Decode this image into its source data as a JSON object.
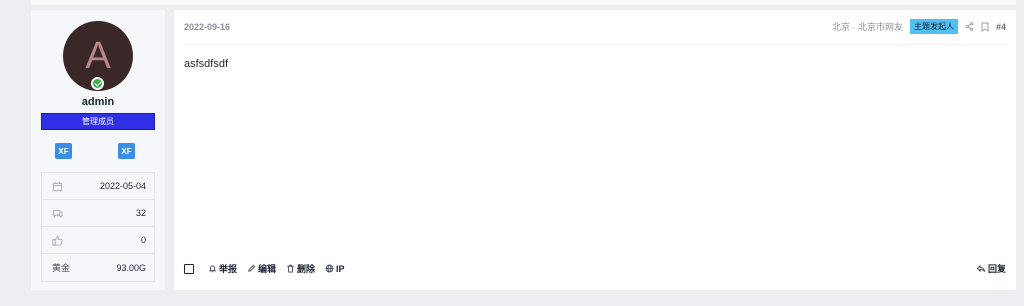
{
  "user": {
    "avatar_letter": "A",
    "name": "admin",
    "role": "管理成员",
    "stats": [
      {
        "icon": "calendar-icon",
        "label": "",
        "value": "2022-05-04"
      },
      {
        "icon": "message-icon",
        "label": "",
        "value": "32"
      },
      {
        "icon": "thumbs-up-icon",
        "label": "",
        "value": "0"
      },
      {
        "icon": "",
        "label": "黄金",
        "value": "93.00G"
      }
    ]
  },
  "post": {
    "date": "2022-09-16",
    "location": "北京 · 北京市网友",
    "starter_badge": "主题发起人",
    "number": "#4",
    "content": "asfsdfsdf",
    "actions": {
      "report": "举报",
      "edit": "编辑",
      "delete": "删除",
      "ip": "IP",
      "reply": "回复"
    }
  },
  "colors": {
    "role_bg": "#3030e6",
    "badge_bg": "#51bff4",
    "online": "#3cae4c",
    "avatar_bg": "#3a2728"
  }
}
